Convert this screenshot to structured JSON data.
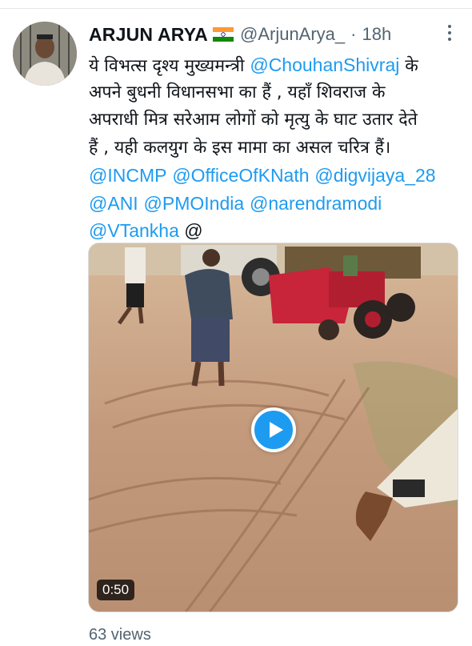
{
  "author": {
    "display_name": "ARJUN ARYA",
    "flag_icon": "india-flag-icon",
    "handle": "@ArjunArya_",
    "separator": "·",
    "time": "18h"
  },
  "tweet": {
    "lines": [
      {
        "segments": [
          {
            "text": "ये विभत्स दृश्य मुख्यमन्त्री ",
            "type": "text"
          },
          {
            "text": "@ChouhanShivraj",
            "type": "mention"
          },
          {
            "text": " के",
            "type": "text"
          }
        ]
      },
      {
        "segments": [
          {
            "text": "अपने बुधनी विधानसभा का हैं , यहाँ शिवराज के",
            "type": "text"
          }
        ]
      },
      {
        "segments": [
          {
            "text": "अपराधी मित्र सरेआम लोगों को मृत्यु के घाट उतार देते",
            "type": "text"
          }
        ]
      },
      {
        "segments": [
          {
            "text": "हैं , यही कलयुग के इस मामा का असल चरित्र हैं।",
            "type": "text"
          }
        ]
      },
      {
        "segments": [
          {
            "text": "@INCMP",
            "type": "mention"
          },
          {
            "text": " ",
            "type": "text"
          },
          {
            "text": "@OfficeOfKNath",
            "type": "mention"
          },
          {
            "text": " ",
            "type": "text"
          },
          {
            "text": "@digvijaya_28",
            "type": "mention"
          }
        ]
      },
      {
        "segments": [
          {
            "text": "@ANI",
            "type": "mention"
          },
          {
            "text": " ",
            "type": "text"
          },
          {
            "text": "@PMOIndia",
            "type": "mention"
          },
          {
            "text": " ",
            "type": "text"
          },
          {
            "text": "@narendramodi",
            "type": "mention"
          }
        ]
      },
      {
        "segments": [
          {
            "text": "@VTankha",
            "type": "mention"
          },
          {
            "text": " @",
            "type": "latin"
          }
        ]
      }
    ]
  },
  "media": {
    "duration": "0:50",
    "play_icon": "play-icon"
  },
  "stats": {
    "views": "63 views"
  },
  "colors": {
    "accent": "#1d9bf0",
    "text": "#0f1419",
    "muted": "#536471"
  }
}
